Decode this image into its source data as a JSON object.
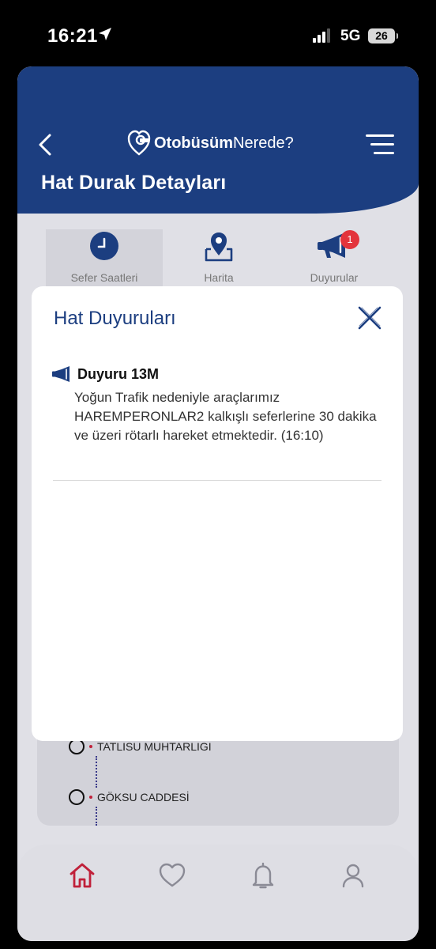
{
  "status_bar": {
    "time": "16:21",
    "network": "5G",
    "battery": "26"
  },
  "header": {
    "logo_bold": "Otobüsüm",
    "logo_light": "Nerede?",
    "title": "Hat Durak Detayları"
  },
  "tabs": [
    {
      "label": "Sefer Saatleri",
      "icon": "clock-icon",
      "active": true
    },
    {
      "label": "Harita",
      "icon": "map-pin-icon",
      "active": false
    },
    {
      "label": "Duyurular",
      "icon": "megaphone-icon",
      "active": false,
      "badge": "1"
    }
  ],
  "stops": [
    {
      "name": "TATLISU MUHTARLIGI"
    },
    {
      "name": "GÖKSU CADDESİ"
    }
  ],
  "modal": {
    "title": "Hat Duyuruları",
    "announcements": [
      {
        "title": "Duyuru 13M",
        "body": "Yoğun Trafik nedeniyle araçlarımız HAREMPERONLAR2 kalkışlı seferlerine 30 dakika ve üzeri rötarlı hareket etmektedir. (16:10)"
      }
    ]
  },
  "bottom_nav": [
    {
      "icon": "home-icon",
      "active": true
    },
    {
      "icon": "heart-icon",
      "active": false
    },
    {
      "icon": "bell-icon",
      "active": false
    },
    {
      "icon": "user-icon",
      "active": false
    }
  ],
  "colors": {
    "primary": "#1c3e80",
    "accent_red": "#c0213a",
    "badge": "#e3343c"
  }
}
